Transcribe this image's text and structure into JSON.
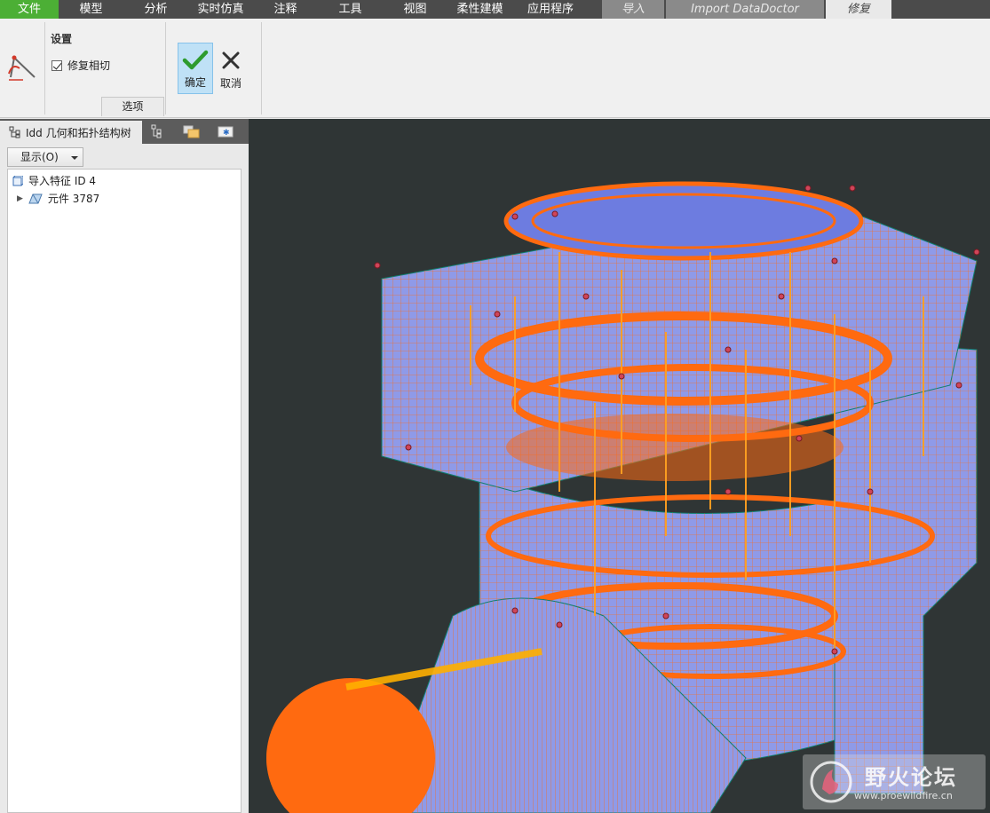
{
  "menubar": {
    "file": "文件",
    "items": [
      "模型",
      "分析",
      "实时仿真",
      "注释",
      "工具",
      "视图",
      "柔性建模",
      "应用程序"
    ],
    "context_tabs": [
      "导入",
      "Import DataDoctor",
      "修复"
    ],
    "active_context_tab": "修复",
    "accent_color": "#4caf35"
  },
  "ribbon": {
    "settings_title": "设置",
    "repair_tangent_label": "修复相切",
    "repair_tangent_checked": true,
    "options_tab": "选项",
    "ok_label": "确定",
    "cancel_label": "取消"
  },
  "left_panel": {
    "tree_tab_label": "Idd 几何和拓扑结构树",
    "display_dropdown": "显示(O)",
    "tree": [
      {
        "label": "导入特征 ID 4",
        "icon": "feature-icon"
      },
      {
        "label": "元件 3787",
        "icon": "part-icon",
        "expandable": true
      }
    ]
  },
  "viewport": {
    "background": "#2f3535",
    "model_color": "#8f9ae8",
    "wire_color": "#ff6a10"
  },
  "watermark": {
    "title": "野火论坛",
    "url": "www.proewildfire.cn"
  }
}
